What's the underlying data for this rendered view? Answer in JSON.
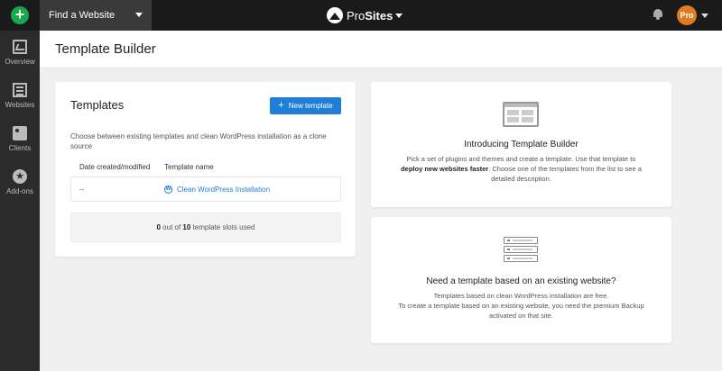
{
  "topbar": {
    "site_selector": "Find a Website",
    "brand_pro": "Pro",
    "brand_sites": "Sites",
    "avatar_label": "Pro"
  },
  "sidebar": {
    "items": [
      {
        "label": "Overview",
        "icon": "overview-icon"
      },
      {
        "label": "Websites",
        "icon": "websites-icon"
      },
      {
        "label": "Clients",
        "icon": "clients-icon"
      },
      {
        "label": "Add-ons",
        "icon": "addons-icon"
      }
    ]
  },
  "page": {
    "title": "Template Builder"
  },
  "templates": {
    "title": "Templates",
    "new_button": "New template",
    "description": "Choose between existing templates and clean WordPress installation as a clone source",
    "columns": [
      "Date created/modified",
      "Template name"
    ],
    "rows": [
      {
        "date": "--",
        "name": "Clean WordPress Installation"
      }
    ],
    "slots": {
      "used": "0",
      "total": "10",
      "text": "out of",
      "suffix": "template slots used"
    }
  },
  "intro": {
    "heading": "Introducing Template Builder",
    "line1": "Pick a set of plugins and themes and create a template. Use that template to",
    "line2_bold": "deploy new websites faster",
    "line2_rest": ". Choose one of the templates from the list to see a",
    "line3": "detailed description."
  },
  "need": {
    "heading": "Need a template based on an existing website?",
    "line1": "Templates based on clean WordPress installation are free.",
    "line2": "To create a template based on an existing website, you need the premium Backup",
    "line3": "activated on that site."
  },
  "colors": {
    "accent": "#1f7ed8",
    "add": "#17a84d",
    "avatar": "#e07b24"
  }
}
